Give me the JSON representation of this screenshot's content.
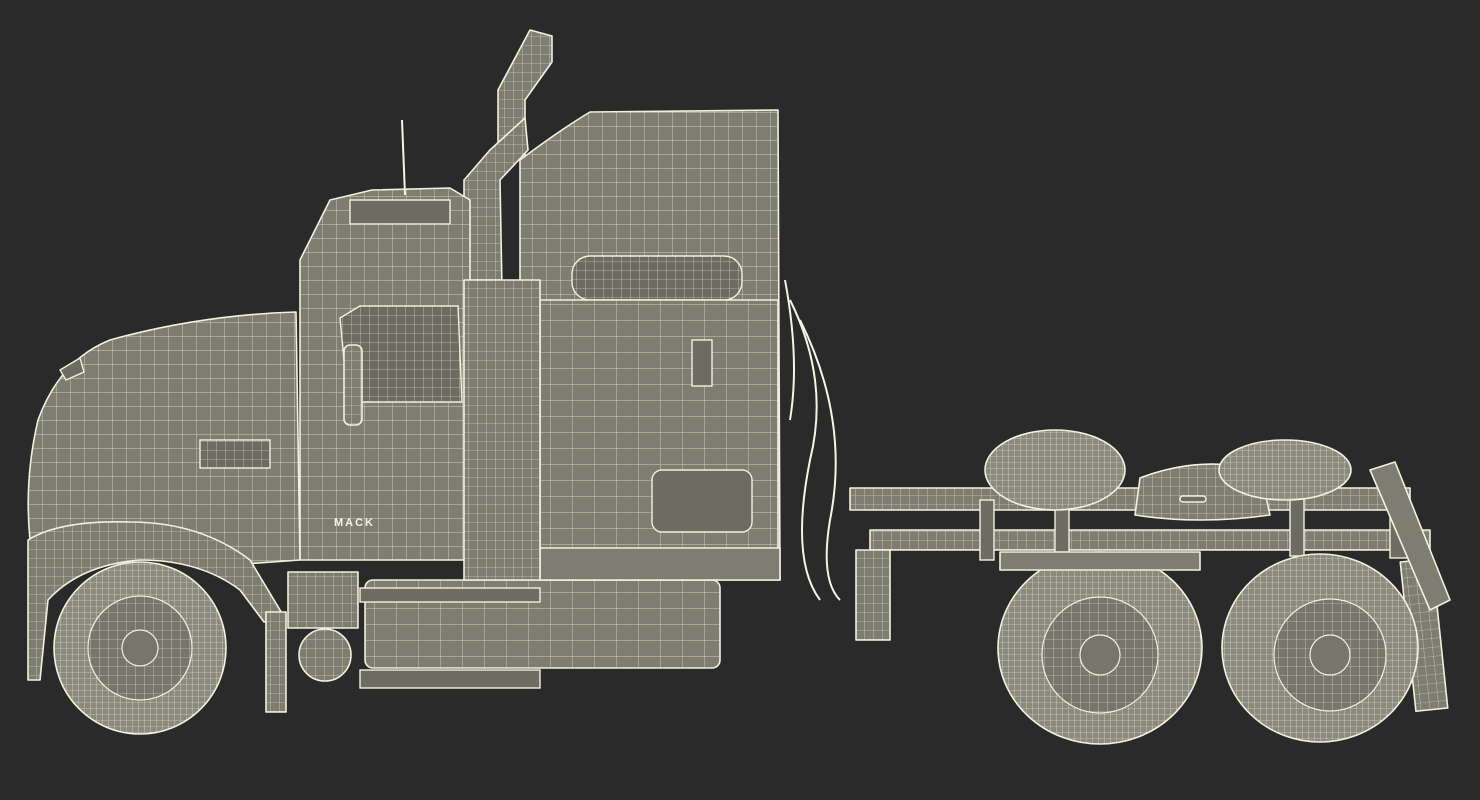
{
  "scene": {
    "subject": "truck-wireframe",
    "background_color": "#2a2a2a",
    "wire_color": "#f2f1dd",
    "surface_color": "#7d7d72"
  },
  "truck": {
    "brand_label": "MACK"
  }
}
